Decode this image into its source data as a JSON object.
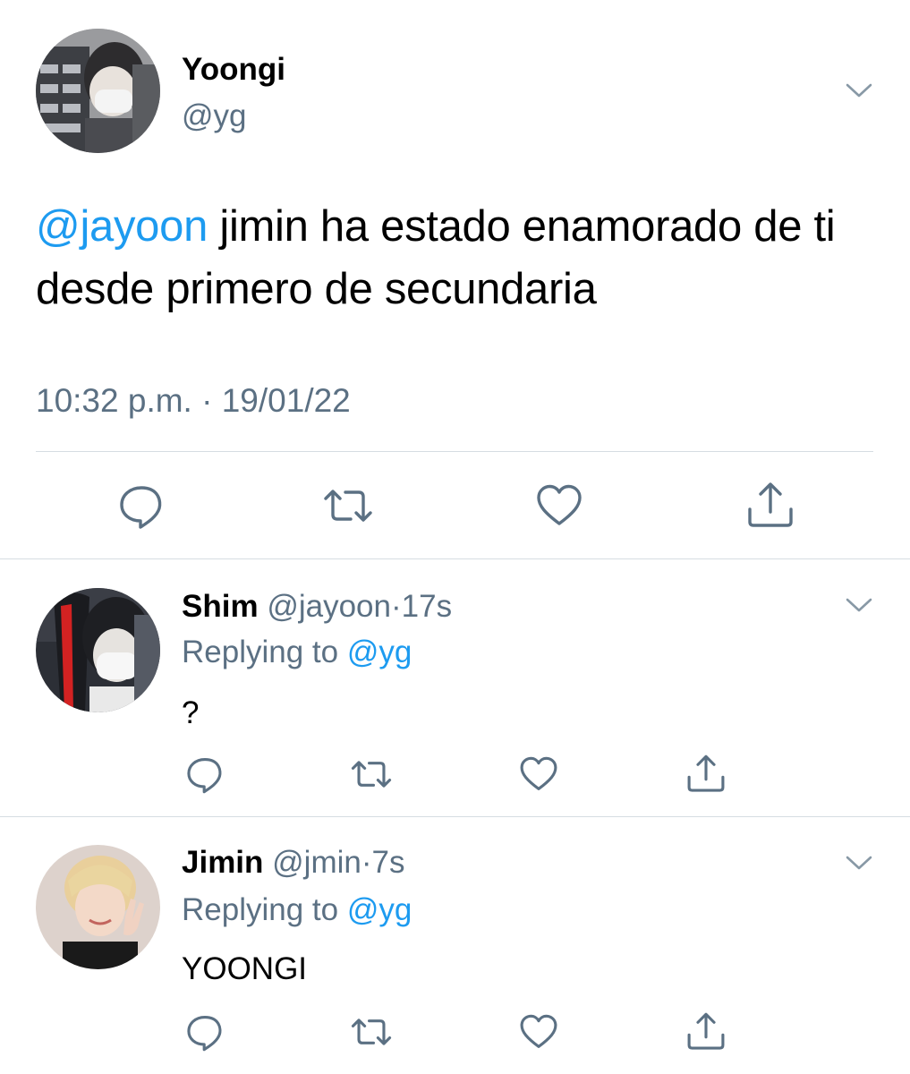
{
  "main_tweet": {
    "author_name": "Yoongi",
    "author_handle": "@yg",
    "mention": "@jayoon",
    "text": " jimin ha estado enamorado de ti desde primero de secundaria",
    "time": "10:32 p.m.",
    "separator": "·",
    "date": "19/01/22",
    "avatar_icon": "avatar-photo"
  },
  "replies": [
    {
      "name": "Shim",
      "handle": "@jayoon",
      "separator": "·",
      "time": "17s",
      "replying_prefix": "Replying to",
      "replying_handle": "@yg",
      "text": "?"
    },
    {
      "name": "Jimin",
      "handle": "@jmin",
      "separator": "·",
      "time": "7s",
      "replying_prefix": "Replying to",
      "replying_handle": "@yg",
      "text": "YOONGI"
    }
  ],
  "icons": {
    "reply": "reply-icon",
    "retweet": "retweet-icon",
    "like": "like-icon",
    "share": "share-icon",
    "more": "chevron-down-icon"
  },
  "colors": {
    "accent": "#1d9bf0",
    "secondary_text": "#5b7083",
    "divider": "#d6dde2",
    "icon": "#5b7083"
  }
}
